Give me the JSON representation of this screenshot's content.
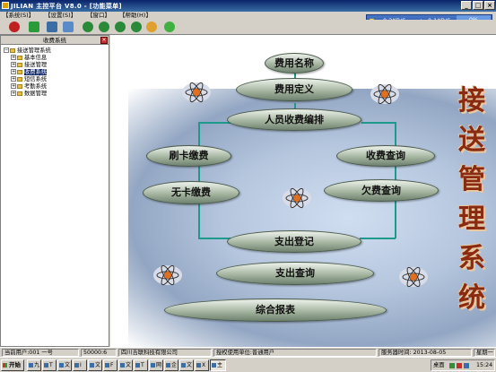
{
  "window": {
    "title": "JILIAN 主控平台 V8.0 - [功能菜单]"
  },
  "menu": [
    "【系统(S)】",
    "【设置(S)】",
    "【窗口】",
    "【帮助(H)】"
  ],
  "netmeter": {
    "down": "0.2KB/S",
    "up": "0.1KB/S",
    "pct": "0%"
  },
  "left_panel": {
    "title": "收费系统",
    "tree": [
      {
        "label": "接送管理系统",
        "level": 0
      },
      {
        "label": "基本信息",
        "level": 1
      },
      {
        "label": "接送管理",
        "level": 1
      },
      {
        "label": "收费系统",
        "level": 1,
        "selected": true
      },
      {
        "label": "短信系统",
        "level": 1
      },
      {
        "label": "考勤系统",
        "level": 1
      },
      {
        "label": "数据管理",
        "level": 1
      }
    ]
  },
  "flow": {
    "nodes": {
      "fee_name": "费用名称",
      "fee_def": "费用定义",
      "staff_bill": "人员收费编排",
      "card_pay": "刷卡缴费",
      "fee_query": "收费查询",
      "no_card_pay": "无卡缴费",
      "arrears_query": "欠费查询",
      "expense_reg": "支出登记",
      "expense_query": "支出查询",
      "report": "综合报表"
    },
    "vertical_title": [
      "接",
      "送",
      "管",
      "理",
      "系",
      "统"
    ]
  },
  "status": {
    "user": "当前用户:001 一号",
    "code": "50000:6",
    "company": "四川吉联科技有限公司",
    "license": "授权使用单位:普通用户",
    "server_time": "服务器时间: 2013-08-05",
    "weekday": "星期一"
  },
  "taskbar": {
    "start": "开始",
    "tasks": [
      "九",
      "T",
      "文",
      "I",
      "文",
      "F",
      "文",
      "T",
      "网",
      "企",
      "文",
      "X",
      "主"
    ],
    "tray_label": "桌面",
    "clock": "15:24"
  },
  "colors": {
    "title_bar": "#0a246a",
    "connector": "#1e9a8c",
    "title_chars": "#8a2a10"
  }
}
